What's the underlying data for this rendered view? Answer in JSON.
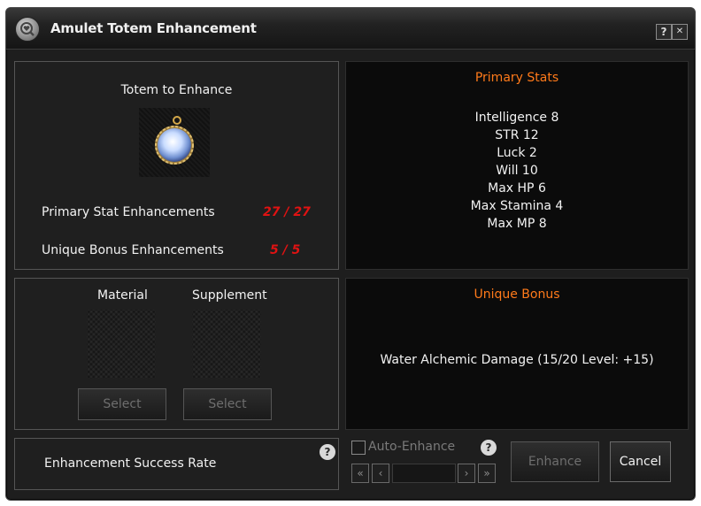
{
  "window": {
    "title": "Amulet Totem Enhancement"
  },
  "titlebar": {
    "help_label": "?",
    "close_label": "✕"
  },
  "totem_panel": {
    "heading": "Totem to Enhance",
    "primary_label": "Primary Stat Enhancements",
    "primary_value": "27 / 27",
    "unique_label": "Unique Bonus Enhancements",
    "unique_value": "5 / 5"
  },
  "materials_panel": {
    "material_label": "Material",
    "supplement_label": "Supplement",
    "select_material_label": "Select",
    "select_supplement_label": "Select"
  },
  "success_panel": {
    "label": "Enhancement Success Rate",
    "help_label": "?"
  },
  "primary_stats": {
    "heading": "Primary Stats",
    "lines": [
      "Intelligence 8",
      "STR 12",
      "Luck 2",
      "Will 10",
      "Max HP 6",
      "Max Stamina 4",
      "Max MP 8"
    ]
  },
  "unique_bonus": {
    "heading": "Unique Bonus",
    "text": "Water Alchemic Damage (15/20 Level: +15)"
  },
  "controls": {
    "auto_enhance_label": "Auto-Enhance",
    "auto_enhance_checked": false,
    "help_label": "?",
    "first_label": "«",
    "prev_label": "‹",
    "next_label": "›",
    "last_label": "»",
    "enhance_label": "Enhance",
    "cancel_label": "Cancel"
  },
  "colors": {
    "accent": "#ff7a1a",
    "maxed": "#e01212"
  }
}
